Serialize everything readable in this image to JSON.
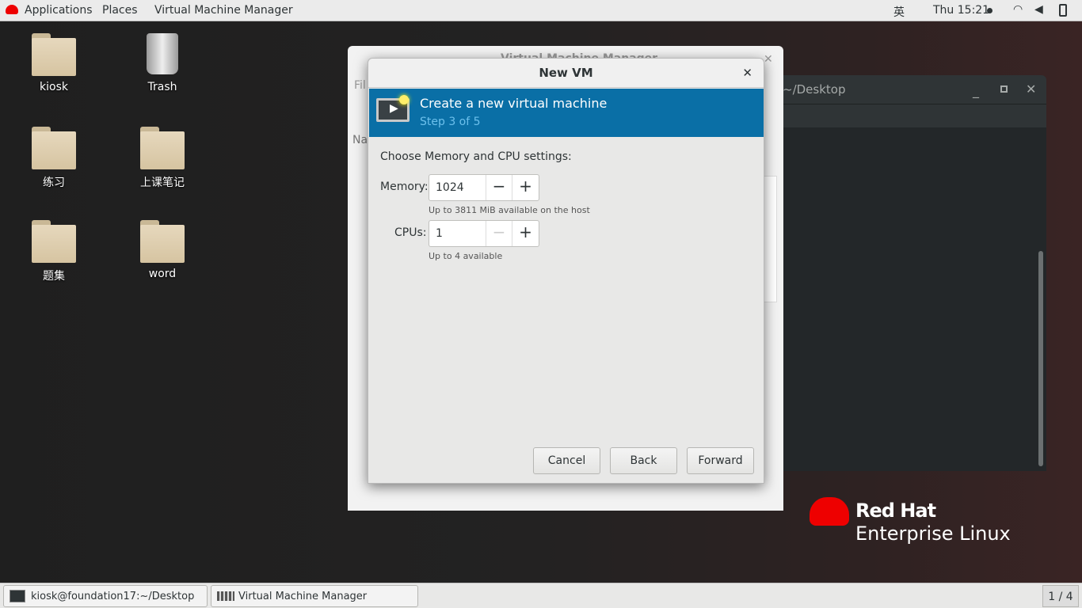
{
  "topbar": {
    "applications": "Applications",
    "places": "Places",
    "app_menu": "Virtual Machine Manager",
    "input_method": "英",
    "clock": "Thu 15:21"
  },
  "desktop": {
    "icons": [
      {
        "label": "kiosk"
      },
      {
        "label": "Trash"
      },
      {
        "label": "练习"
      },
      {
        "label": "上课笔记"
      },
      {
        "label": "题集"
      },
      {
        "label": "word"
      }
    ]
  },
  "terminal": {
    "title": "~/Desktop"
  },
  "vmm": {
    "title": "Virtual Machine Manager",
    "menu_file": "Fil",
    "col_name": "Na"
  },
  "dialog": {
    "title": "New VM",
    "banner_title": "Create a new virtual machine",
    "banner_step": "Step 3 of 5",
    "prompt": "Choose Memory and CPU settings:",
    "memory_label": "Memory:",
    "memory_value": "1024",
    "memory_hint": "Up to 3811 MiB available on the host",
    "cpus_label": "CPUs:",
    "cpus_value": "1",
    "cpus_hint": "Up to 4 available",
    "cancel": "Cancel",
    "back": "Back",
    "forward": "Forward",
    "minus": "−",
    "plus": "+"
  },
  "brand": {
    "line1": "Red Hat",
    "line2": "Enterprise Linux",
    "color": "#ee0000"
  },
  "taskbar": {
    "items": [
      {
        "label": "kiosk@foundation17:~/Desktop"
      },
      {
        "label": "Virtual Machine Manager"
      }
    ],
    "workspace": "1 / 4"
  }
}
